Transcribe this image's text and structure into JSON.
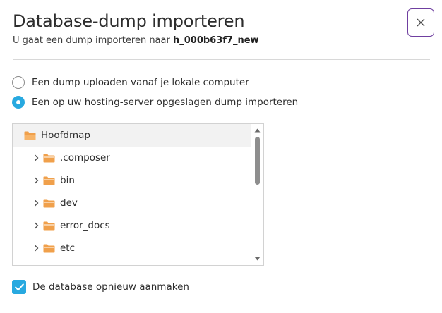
{
  "dialog": {
    "title": "Database-dump importeren",
    "subtitle_prefix": "U gaat een dump importeren naar",
    "database_name": "h_000b63f7_new",
    "close_icon": "close-icon"
  },
  "source_options": [
    {
      "label": "Een dump uploaden vanaf je lokale computer",
      "selected": false
    },
    {
      "label": "Een op uw hosting-server opgeslagen dump importeren",
      "selected": true
    }
  ],
  "file_tree": {
    "root": {
      "label": "Hoofdmap",
      "icon": "folder-open-icon"
    },
    "items": [
      {
        "label": ".composer",
        "icon": "folder-icon"
      },
      {
        "label": "bin",
        "icon": "folder-icon"
      },
      {
        "label": "dev",
        "icon": "folder-icon"
      },
      {
        "label": "error_docs",
        "icon": "folder-icon"
      },
      {
        "label": "etc",
        "icon": "folder-icon"
      }
    ]
  },
  "recreate_database": {
    "label": "De database opnieuw aanmaken",
    "checked": true
  },
  "colors": {
    "accent": "#28a9e0",
    "close_border": "#6f3fa0",
    "folder": "#f0a04b",
    "root_row_bg": "#f2f2f2"
  }
}
